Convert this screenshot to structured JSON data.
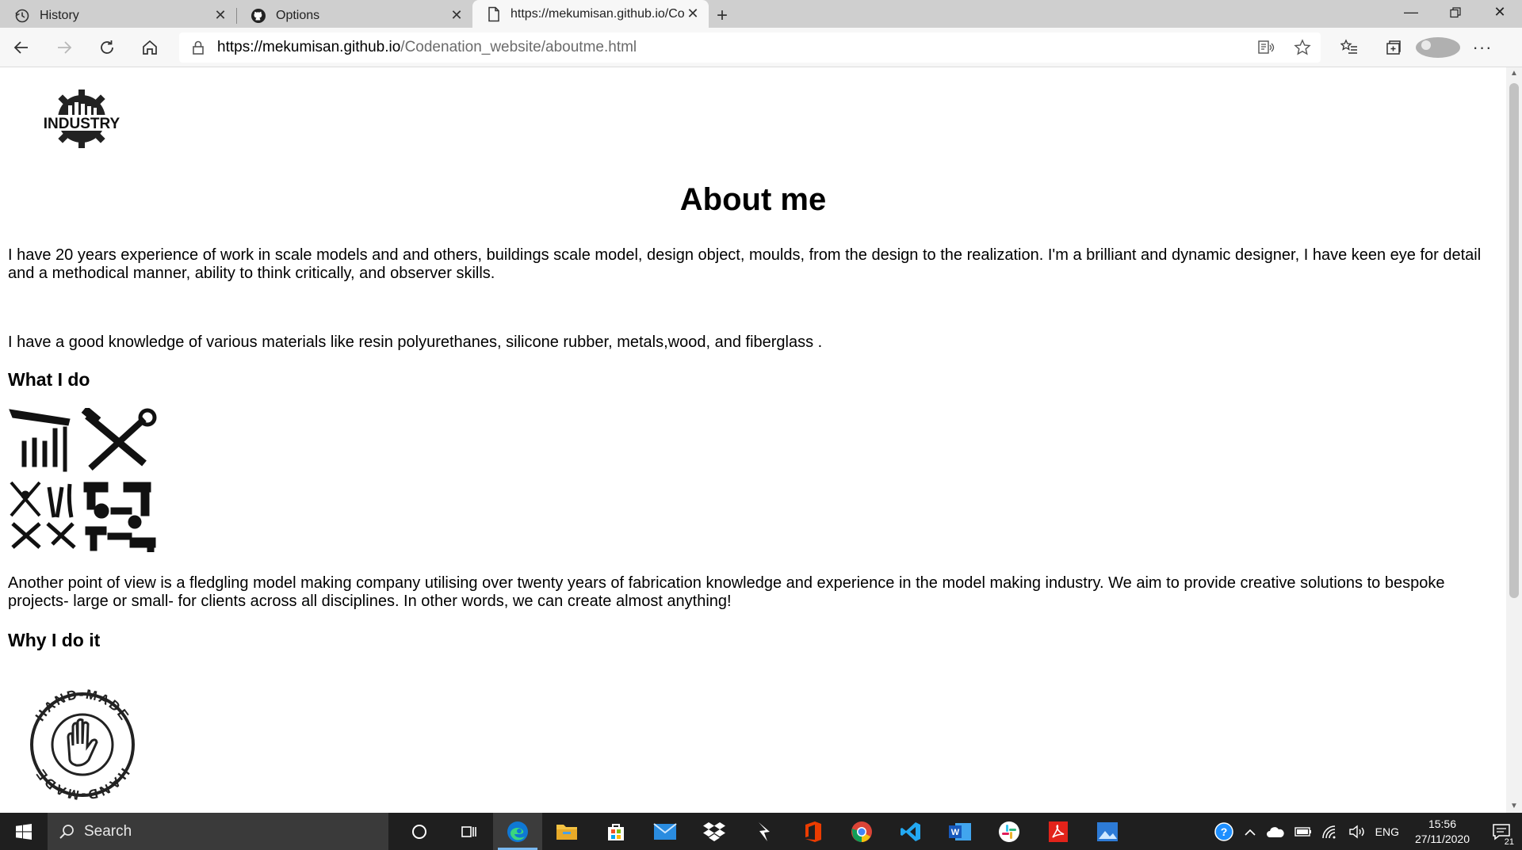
{
  "browser": {
    "tabs": [
      {
        "title": "History",
        "icon": "history-icon"
      },
      {
        "title": "Options",
        "icon": "github-icon"
      },
      {
        "title": "https://mekumisan.github.io/Codenation_website/aboutme.html",
        "icon": "page-icon",
        "active": true
      }
    ],
    "url_host": "https://mekumisan.github.io",
    "url_path": "/Codenation_website/aboutme.html"
  },
  "page": {
    "logo_text": "INDUSTRY",
    "title": "About me",
    "intro": "I have 20 years experience of work in scale models and and others, buildings scale model, design object, moulds, from the design to the realization. I'm a brilliant and dynamic designer, I have keen eye for detail and a methodical manner, ability to think critically, and observer skills.",
    "materials": "I have a good knowledge of various materials like resin polyurethanes, silicone rubber, metals,wood, and fiberglass .",
    "what_heading": "What I do",
    "what_text": "Another point of view is a fledgling model making company utilising over twenty years of fabrication knowledge and experience in the model making industry. We aim to provide creative solutions to bespoke projects- large or small- for clients across all disciplines. In other words, we can create almost anything!",
    "why_heading": "Why I do it",
    "stamp_text": "HAND-MADE"
  },
  "taskbar": {
    "search_placeholder": "Search",
    "language": "ENG",
    "time": "15:56",
    "date": "27/11/2020",
    "notifications": "21"
  },
  "colors": {
    "tabstrip": "#cfcfcf",
    "toolbar": "#f7f7f7",
    "taskbar": "#1f1f1f",
    "edge_blue": "#0f78d4"
  }
}
